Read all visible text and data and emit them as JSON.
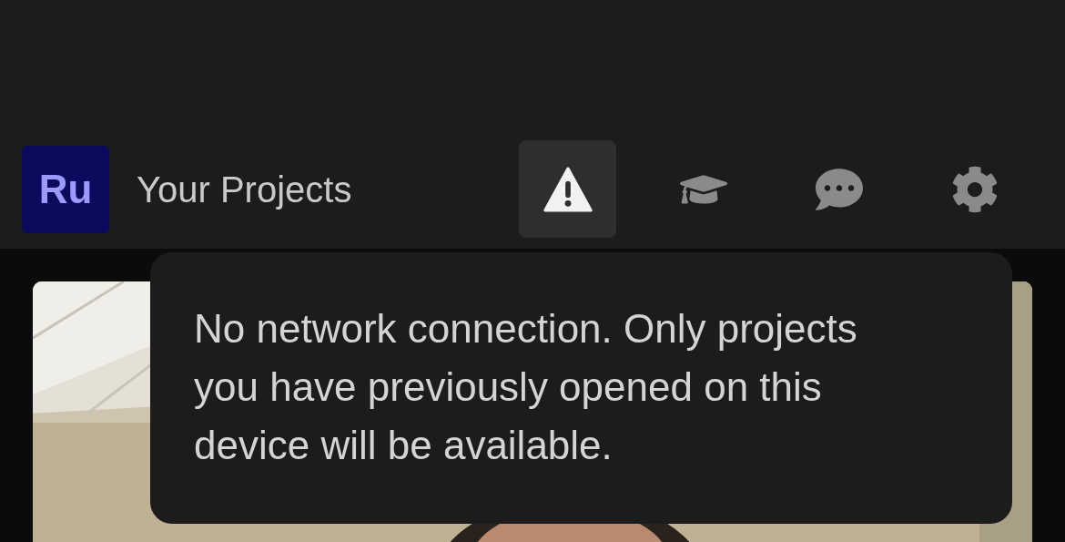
{
  "header": {
    "logo": "Ru",
    "title": "Your Projects"
  },
  "toolbar": [
    {
      "kind": "warning",
      "selected": true
    },
    {
      "kind": "learn",
      "selected": false
    },
    {
      "kind": "chat",
      "selected": false
    },
    {
      "kind": "settings",
      "selected": false
    }
  ],
  "tooltip": {
    "message": "No network connection. Only projects you have previously opened on this device will be available."
  }
}
